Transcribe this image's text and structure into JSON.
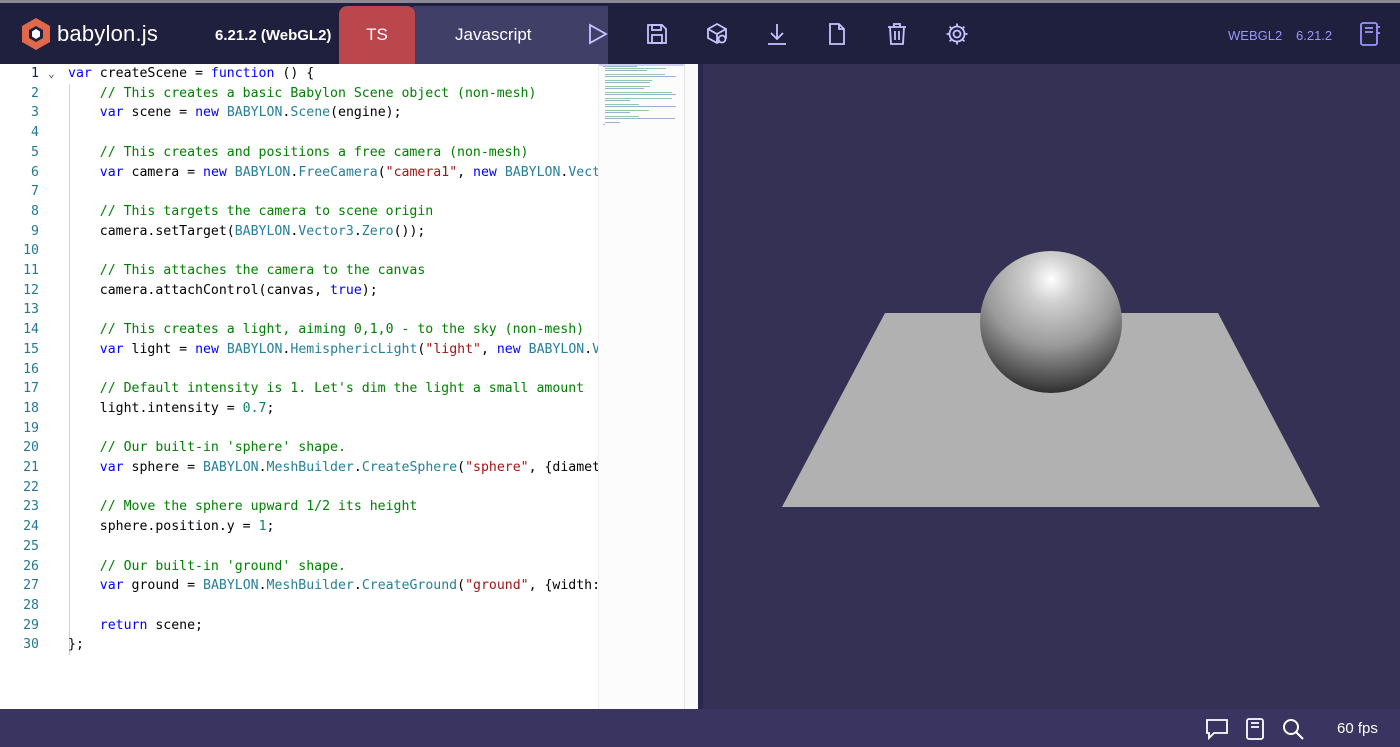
{
  "header": {
    "logo_text": "babylon.js",
    "version_label": "6.21.2 (WebGL2)",
    "tabs": [
      {
        "label": "TS"
      },
      {
        "label": "Javascript"
      }
    ],
    "toolbar_icons": [
      "play-icon",
      "save-icon",
      "inspector-icon",
      "download-icon",
      "new-file-icon",
      "clear-icon",
      "settings-icon"
    ],
    "engine_label": "WEBGL2",
    "engine_version": "6.21.2",
    "examples_icon": "examples-icon"
  },
  "editor": {
    "current_line": 1,
    "lines": [
      {
        "n": "1",
        "fold": "⌄",
        "code": "var createScene = function () {"
      },
      {
        "n": "2",
        "code": "    // This creates a basic Babylon Scene object (non-mesh)"
      },
      {
        "n": "3",
        "code": "    var scene = new BABYLON.Scene(engine);"
      },
      {
        "n": "4",
        "code": ""
      },
      {
        "n": "5",
        "code": "    // This creates and positions a free camera (non-mesh)"
      },
      {
        "n": "6",
        "code": "    var camera = new BABYLON.FreeCamera(\"camera1\", new BABYLON.Vecto"
      },
      {
        "n": "7",
        "code": ""
      },
      {
        "n": "8",
        "code": "    // This targets the camera to scene origin"
      },
      {
        "n": "9",
        "code": "    camera.setTarget(BABYLON.Vector3.Zero());"
      },
      {
        "n": "10",
        "code": ""
      },
      {
        "n": "11",
        "code": "    // This attaches the camera to the canvas"
      },
      {
        "n": "12",
        "code": "    camera.attachControl(canvas, true);"
      },
      {
        "n": "13",
        "code": ""
      },
      {
        "n": "14",
        "code": "    // This creates a light, aiming 0,1,0 - to the sky (non-mesh)"
      },
      {
        "n": "15",
        "code": "    var light = new BABYLON.HemisphericLight(\"light\", new BABYLON.Ve"
      },
      {
        "n": "16",
        "code": ""
      },
      {
        "n": "17",
        "code": "    // Default intensity is 1. Let's dim the light a small amount"
      },
      {
        "n": "18",
        "code": "    light.intensity = 0.7;"
      },
      {
        "n": "19",
        "code": ""
      },
      {
        "n": "20",
        "code": "    // Our built-in 'sphere' shape."
      },
      {
        "n": "21",
        "code": "    var sphere = BABYLON.MeshBuilder.CreateSphere(\"sphere\", {diamete"
      },
      {
        "n": "22",
        "code": ""
      },
      {
        "n": "23",
        "code": "    // Move the sphere upward 1/2 its height"
      },
      {
        "n": "24",
        "code": "    sphere.position.y = 1;"
      },
      {
        "n": "25",
        "code": ""
      },
      {
        "n": "26",
        "code": "    // Our built-in 'ground' shape."
      },
      {
        "n": "27",
        "code": "    var ground = BABYLON.MeshBuilder.CreateGround(\"ground\", {width:"
      },
      {
        "n": "28",
        "code": ""
      },
      {
        "n": "29",
        "code": "    return scene;"
      },
      {
        "n": "30",
        "code": "};"
      }
    ]
  },
  "footer": {
    "icons": [
      "feedback-icon",
      "docs-icon",
      "search-icon"
    ],
    "fps": "60 fps"
  },
  "colors": {
    "header_bg": "#1f1f3e",
    "ts_tab": "#bb464b",
    "js_tab": "#3f3f68",
    "accent": "#9c95ff",
    "viewport_bg": "#343154"
  }
}
